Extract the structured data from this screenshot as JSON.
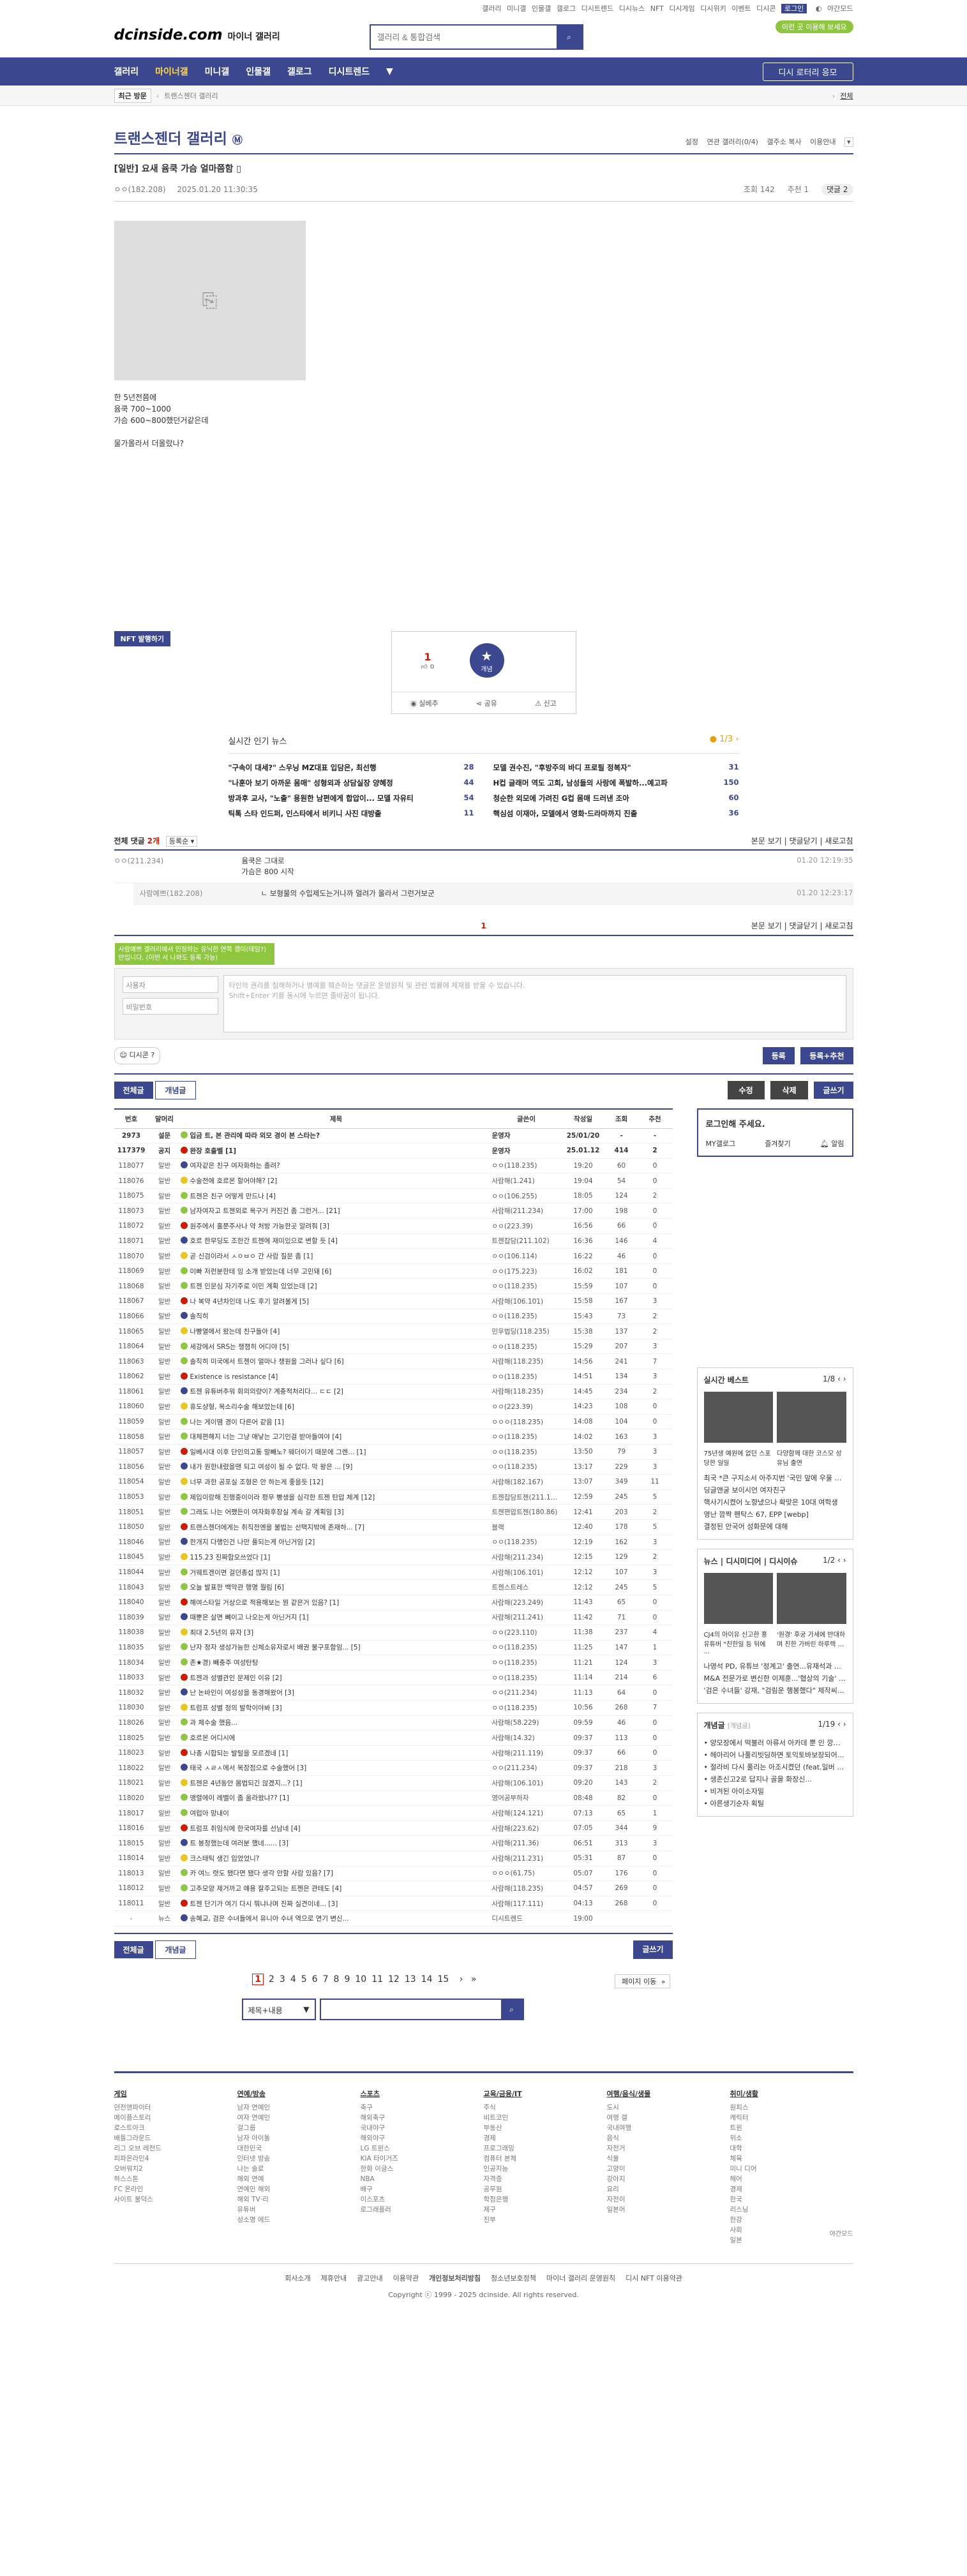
{
  "top_util": [
    "갤러리",
    "미니갤",
    "인물갤",
    "갤로그",
    "디시트렌드",
    "디시뉴스",
    "NFT",
    "디시게임",
    "디시위키",
    "이벤트",
    "디시콘"
  ],
  "top_login": "로그인",
  "top_dark": "야간모드",
  "logo": {
    "main": "dcinside.com",
    "sub": "마이너 갤러리"
  },
  "search": {
    "placeholder": "갤러리 & 통합검색"
  },
  "green_pill": "이런 곳 이용해 보세요",
  "gnb": {
    "items": [
      "갤러리",
      "마이너갤",
      "미니갤",
      "인물갤",
      "갤로그",
      "디시트렌드"
    ],
    "button": "디시 로터리 응모"
  },
  "subbar": {
    "recent": "최근 방문",
    "right": "전체"
  },
  "gallery": {
    "title": "트랜스젠더 갤러리",
    "badge": "Ⓜ",
    "options": [
      "설정",
      "연관 갤러리(0/4)",
      "갤주소 복사",
      "이용안내"
    ]
  },
  "post": {
    "title": "[일반] 요새 윰쿡 가슴 얼마쯤함",
    "author": "ㅇㅇ(182.208)",
    "date": "2025.01.20 11:30:35",
    "views": "조회 142",
    "recs": "추천 1",
    "comments_badge": "댓글 2",
    "body": [
      "한 5년전쯤에",
      "윰쿡 700~1000",
      "가슴 600~800했던거같은데",
      "",
      "물가올라서 더올랐나?"
    ]
  },
  "nft_button": "NFT 발행하기",
  "recommend": {
    "up": "1",
    "sub": "0",
    "fix_label": "개념",
    "buttons": [
      "실베추",
      "공유",
      "신고"
    ]
  },
  "news": {
    "title": "실시간 인기 뉴스",
    "page": "1/3",
    "items": [
      {
        "t": "\"구속이 대세?\" 스우닝 MZ대표 입담은, 최선행",
        "c": "28"
      },
      {
        "t": "모델 권수진, \"후방주의 바디 프로필 정복자\"",
        "c": "31"
      },
      {
        "t": "\"나훈아 보기 아까운 몸매\" 성형외과 상담실장 양혜정",
        "c": "44"
      },
      {
        "t": "H컵 글래머 역도 고희, 남성들의 사랑에 폭발하...예고파",
        "c": "150"
      },
      {
        "t": "방과후 교사, \"노출\" 용원한 남편에게 합압이... 모델 자유티",
        "c": "54"
      },
      {
        "t": "청순한 외모에 가려진 G컵 몸매 드러낸 조아",
        "c": "60"
      },
      {
        "t": "틱톡 스타 인드퍼, 인스타에서 비키니 사진 대방출",
        "c": "11"
      },
      {
        "t": "핵심섬 이재아, 모델에서 영화·드라마까지 진출",
        "c": "36"
      }
    ]
  },
  "comments": {
    "label": "전체 댓글",
    "count": "2개",
    "sort": "등록순",
    "right": [
      "본문 보기",
      "댓글닫기",
      "새로고침"
    ],
    "rows": [
      {
        "nick": "ㅇㅇ(211.234)",
        "txt": "윰쿡은 그대로\n가슴은 800 시작",
        "dt": "01.20 12:19:35"
      },
      {
        "nick": "사람예쁘(182.208)",
        "txt": "ㄴ 보형물의 수입제도는거나까 얼려가 올라서 그런거보군",
        "dt": "01.20 12:23:17"
      }
    ],
    "page": "1"
  },
  "write": {
    "tip": "사람예쁘 갤러리에서 인정하는 유닉한 연쪽 갤미(데임?)만입니다. (이번 서 나와도 등록 가능)",
    "nick": "사용자",
    "pw": "비밀번호",
    "area": "타인의 권리를 침해하거나 명예를 훼손하는 댓글은 운영원칙 및 관련 법률에 제재를 받을 수 있습니다.\nShift+Enter 키를 동시에 누르면 줄바꿈이 됩니다.",
    "dccon": "디시콘",
    "submit": "등록",
    "submit_rec": "등록+추천"
  },
  "tabs": {
    "all": "전체글",
    "concept": "개념글",
    "edit": "수정",
    "delete": "삭제",
    "write": "글쓰기"
  },
  "table": {
    "headers": [
      "번호",
      "말머리",
      "제목",
      "글쓴이",
      "작성일",
      "조회",
      "추천"
    ],
    "rows": [
      [
        "2973",
        "설문",
        "입금 트, 본 관리에 따라 외모 경이 본 스타는?",
        "운영자",
        "25/01/20",
        "-",
        "-"
      ],
      [
        "117379",
        "공지",
        "완장 호출벨 [1]",
        "운영자",
        "25.01.12",
        "414",
        "2"
      ],
      [
        "118077",
        "일반",
        "여자같은 친구 여자화하는 졸려?",
        "ㅇㅇ(118.235)",
        "19:20",
        "60",
        "0"
      ],
      [
        "118076",
        "일반",
        "수술전에 호르몬 할어야해? [2]",
        "사람해(1.241)",
        "19:04",
        "54",
        "0"
      ],
      [
        "118075",
        "일반",
        "트젠은 친구 어떻게 만드나 [4]",
        "ㅇㅇ(106.255)",
        "18:05",
        "124",
        "2"
      ],
      [
        "118073",
        "일반",
        "남자여자고 트젠외로 목구거 커진건 좀 그런거... [21]",
        "사람해(211.234)",
        "17:00",
        "198",
        "0"
      ],
      [
        "118072",
        "일반",
        "원주에서 훌쭌주사나 약 처방 가능한곳 알려줘 [3]",
        "ㅇㅇ(223.39)",
        "16:56",
        "66",
        "0"
      ],
      [
        "118071",
        "일반",
        "호르 한무딩도 조한간 트젠에 재미있으로 변할 듯 [4]",
        "트젠잡담(211.102)",
        "16:36",
        "146",
        "4"
      ],
      [
        "118070",
        "일반",
        "곧 신검이라서 ㅅㅇㅂㅇ 간 사람 질문 좀 [1]",
        "ㅇㅇ(106.114)",
        "16:22",
        "46",
        "0"
      ],
      [
        "118069",
        "일반",
        "이빠 저런분한테 잉 소개 받았는데 너무 고민돼 [6]",
        "ㅇㅇ(175.223)",
        "16:02",
        "181",
        "0"
      ],
      [
        "118068",
        "일반",
        "트젠 인문심 자기주로 이민 계획 있었는데 [2]",
        "ㅇㅇ(118.235)",
        "15:59",
        "107",
        "0"
      ],
      [
        "118067",
        "일반",
        "나 복약 4년차인데 나도 후기 알려볼게 [5]",
        "사람해(106.101)",
        "15:58",
        "167",
        "3"
      ],
      [
        "118066",
        "일반",
        "솔직히",
        "ㅇㅇ(118.235)",
        "15:43",
        "73",
        "2"
      ],
      [
        "118065",
        "일반",
        "나빵열에서 왔는데 친구들아 [4]",
        "민우법딩(118.235)",
        "15:38",
        "137",
        "2"
      ],
      [
        "118064",
        "일반",
        "세강에서 SRS는 챙졈히 어디야 [5]",
        "ㅇㅇ(118.235)",
        "15:29",
        "207",
        "3"
      ],
      [
        "118063",
        "일반",
        "솔직히 미국에서 트젠이 얼마나 챙원을 그러나 싶다 [6]",
        "사람해(118.235)",
        "14:56",
        "241",
        "7"
      ],
      [
        "118062",
        "일반",
        "Existence is resistance [4]",
        "ㅇㅇ(118.235)",
        "14:51",
        "134",
        "3"
      ],
      [
        "118061",
        "일반",
        "트젠 유튜버추워 회의의량이? 계충적처리다... ㄷㄷ [2]",
        "사람해(118.235)",
        "14:45",
        "234",
        "2"
      ],
      [
        "118060",
        "일반",
        "휴도샹형, 목소리수술 해보았는데 [6]",
        "ㅇㅇ(223.39)",
        "14:23",
        "108",
        "0"
      ],
      [
        "118059",
        "일반",
        "나는 게이땜 경이 다른어 같음 [1]",
        "ㅇㅇㅇ(118.235)",
        "14:08",
        "104",
        "0"
      ],
      [
        "118058",
        "일반",
        "대체편해지 너는 그냥 애낳는 고기인걸 받아들여야 [4]",
        "ㅇㅇ(118.235)",
        "14:02",
        "163",
        "3"
      ],
      [
        "118057",
        "일반",
        "일베시대 이후 단인의고통 말빼노? 웨더이기 때문에 그렌... [1]",
        "ㅇㅇ(118.235)",
        "13:50",
        "79",
        "3"
      ],
      [
        "118056",
        "일반",
        "내가 원한내렸을땐 되고 여성이 될 수 없다. 막 왕은 ... [9]",
        "ㅇㅇ(118.235)",
        "13:17",
        "229",
        "3"
      ],
      [
        "118054",
        "일반",
        "너무 과한 공포실 조형은 안 하는게 좋을듯 [12]",
        "사람해(182.167)",
        "13:07",
        "349",
        "11"
      ],
      [
        "118053",
        "일반",
        "제입이랑해 진행중이이라 평무 빵생을 심각한 트젠 탄압 체계 [12]",
        "트젠잡담트젠(211.102)",
        "12:59",
        "245",
        "5"
      ],
      [
        "118051",
        "일반",
        "그래도 나는 어쨌든이 여자화후장실 계속 갈 계획임 [3]",
        "트젠편압트젠(180.86)",
        "12:41",
        "203",
        "2"
      ],
      [
        "118050",
        "일반",
        "트랜스젠더에게는 취직전엔을 불법는 선택지밖에 존재하... [7]",
        "블랙",
        "12:40",
        "178",
        "5"
      ],
      [
        "118046",
        "일반",
        "한개지 다행인건 나만 풀되는게 아닌거임 [2]",
        "ㅇㅇ(118.235)",
        "12:19",
        "162",
        "3"
      ],
      [
        "118045",
        "일반",
        "115.23 진짜합오쓰었다 [1]",
        "사람해(211.234)",
        "12:15",
        "129",
        "2"
      ],
      [
        "118044",
        "일반",
        "거웨트겐이면 걸던총섭 많지 [1]",
        "사람해(106.101)",
        "12:12",
        "107",
        "3"
      ],
      [
        "118043",
        "일반",
        "오늘 발표한 백악관 행명 뭘림 [6]",
        "트젠스트레스",
        "12:12",
        "245",
        "5"
      ],
      [
        "118040",
        "일반",
        "해여스타일 거상으로 적용해보는 뭔 같은거 있음? [1]",
        "사람해(223.249)",
        "11:43",
        "65",
        "0"
      ],
      [
        "118039",
        "일반",
        "때뿐은 살면 뼤이고 나오는게 아닌거지 [1]",
        "사람해(211.241)",
        "11:42",
        "71",
        "0"
      ],
      [
        "118038",
        "일반",
        "최대 2.5년의 유자 [3]",
        "ㅇㅇ(223.110)",
        "11:38",
        "237",
        "4"
      ],
      [
        "118035",
        "일반",
        "난자 정자 생성가능한 신체소유자로서 배권 불구포함임... [5]",
        "ㅇㅇ(118.235)",
        "11:25",
        "147",
        "1"
      ],
      [
        "118034",
        "일반",
        "존★경) 빼충주 여성탄탕",
        "ㅇㅇ(118.235)",
        "11:21",
        "124",
        "3"
      ],
      [
        "118033",
        "일반",
        "트젠과 성별관인 문제인 이유 [2]",
        "ㅇㅇ(118.235)",
        "11:14",
        "214",
        "6"
      ],
      [
        "118032",
        "일반",
        "난 논바인이 여성성을 동경해왔어 [3]",
        "ㅇㅇ(211.234)",
        "11:13",
        "64",
        "0"
      ],
      [
        "118030",
        "일반",
        "트럼프 성별 정의 발학이야봐 [3]",
        "ㅇㅇ(118.235)",
        "10:56",
        "268",
        "7"
      ],
      [
        "118026",
        "일반",
        "과 체수술 했음...",
        "사람해(58.229)",
        "09:59",
        "46",
        "0"
      ],
      [
        "118025",
        "일반",
        "호르몬 어디시에",
        "사람해(14.32)",
        "09:37",
        "113",
        "0"
      ],
      [
        "118023",
        "일반",
        "나총 시합되는 발털을 모르겠네 [1]",
        "사람해(211.119)",
        "09:37",
        "66",
        "0"
      ],
      [
        "118022",
        "일반",
        "태국 ㅅㄹㅅ에서 목장점으로 수술했어 [3]",
        "ㅇㅇ(211.234)",
        "09:37",
        "218",
        "3"
      ],
      [
        "118021",
        "일반",
        "트젠은 4년동안 몸법되긴 않겠지...? [1]",
        "사람해(106.101)",
        "09:20",
        "143",
        "2"
      ],
      [
        "118020",
        "일반",
        "맹렬에이 레벨이 좀 올라왔냐?? [1]",
        "영어공부하자",
        "08:48",
        "82",
        "0"
      ],
      [
        "118017",
        "일반",
        "여럽아 망내이",
        "사람해(124.121)",
        "07:13",
        "65",
        "1"
      ],
      [
        "118016",
        "일반",
        "트럼프 취임식에 한국여자를 선남네 [4]",
        "사람해(223.62)",
        "07:05",
        "344",
        "9"
      ],
      [
        "118015",
        "일반",
        "트 봉정했는데 여러분 했네...... [3]",
        "사람해(211.36)",
        "06:51",
        "313",
        "3"
      ],
      [
        "118014",
        "일반",
        "크스태틱 생긴 입었었니?",
        "사람해(211.231)",
        "05:31",
        "87",
        "0"
      ],
      [
        "118013",
        "일반",
        "카 여느 렷도 됐다면 됐다 생각 안할 사람 있음? [7]",
        "ㅇㅇㅇ(61.75)",
        "05:07",
        "176",
        "0"
      ],
      [
        "118012",
        "일반",
        "고추모양 제거까고 얘용 잘주고되는 트젠은 관테도 [4]",
        "사람해(118.235)",
        "04:57",
        "269",
        "0"
      ],
      [
        "118011",
        "일반",
        "트젠 단기가 여기 다시 뭐냐나며 진짜 실견이네... [3]",
        "사람해(117.111)",
        "04:13",
        "268",
        "0"
      ],
      [
        "-",
        "뉴스",
        "송혜교, 검은 수녀들에서 유니아 수녀 역으로 연기 변신...",
        "디시트렌드",
        "19:00",
        "",
        ""
      ]
    ]
  },
  "side": {
    "login_title": "로그인해 주세요.",
    "login_btns": [
      "MY갤로그",
      "즐겨찾기",
      "알림"
    ],
    "best_title": "실시간 베스트",
    "best_page": "1/8",
    "best_caps": [
      "75년생 예원에 없던 스포 당한 일일",
      "다양함께 대한 코스모 성 유님 출연"
    ],
    "best_list": [
      "최국 *큰 구지소서 아주지번 '국민 앞에 우울 결과를...",
      "딩글앤굴 보이시언 여자친구",
      "핵사기시켰어 노향냈으나 확맞은 10대 여학생",
      "영난 깜짝 펜탁스 67, EPP [webp]",
      "결정된 안국어 성화문에 대해"
    ],
    "news_tabs": [
      "뉴스",
      "디시미디어",
      "디시이슈"
    ],
    "news_page": "1/2",
    "news_caps": [
      "CJ4의 아이유 신고한 홍 유튜버 \"친한일 등 뒤에 ...",
      "'원경' 후궁 가세에 반대하며 친한 가버린 하루렉 ..."
    ],
    "news_list": [
      "나영석 PD, 유튜브 '정계고' 출연...유재석과 예능 ...",
      "M&A 전문가로 변신한 이제훈...'협상의 기술' 3월 ...",
      "'검은 수녀들' 강재, \"검림운 행봉했다\" 제작씨아 인..."
    ],
    "concept_title": "개념글",
    "concept_tag": "[개념글]",
    "concept_page": "1/19",
    "concept_list": [
      "양모장에서 떡불러 아류서 아카데 뿐 인 깡지기?",
      "헤아리어 나풀리빗딩하면 토익토바보장되어야?",
      "절라비 다시 풀리는 아조시켰던 (feat.일버 너 혹...",
      "생존신고2로 답지나 골을 화장신...",
      "비겨된 아이소자밀",
      "아른생기순자 획틸"
    ]
  },
  "pagination": {
    "pages": [
      "1",
      "2",
      "3",
      "4",
      "5",
      "6",
      "7",
      "8",
      "9",
      "10",
      "11",
      "12",
      "13",
      "14",
      "15"
    ],
    "next": "다음",
    "last": "끝",
    "move": "페이지 이동"
  },
  "bottom_search": {
    "select": "제목+내용"
  },
  "sitemap": [
    {
      "h": "게임",
      "items": [
        "던전앤파이터",
        "메이플스토리",
        "로스트아크",
        "배틀그라운드",
        "리그 오브 레전드",
        "피파온라인4",
        "오버워치2",
        "하스스톤",
        "FC 온라인",
        "사이트 불덕스"
      ]
    },
    {
      "h": "연예/방송",
      "items": [
        "남자 연예인",
        "여자 연예인",
        "걸그룹",
        "남자 아이돌",
        "대한민국",
        "인터넷 방송",
        "나는 솔로",
        "해외 연예",
        "연예인 해외",
        "해외 TV·리",
        "유튜버",
        "성소명 에드"
      ]
    },
    {
      "h": "스포츠",
      "items": [
        "축구",
        "해외축구",
        "국내야구",
        "해외야구",
        "LG 트윈스",
        "KIA 타이거즈",
        "한화 이글스",
        "NBA",
        "배구",
        "이스포츠",
        "로그래플러"
      ]
    },
    {
      "h": "교육/금융/IT",
      "items": [
        "주식",
        "비트코인",
        "부동산",
        "경제",
        "프로그래밍",
        "컴퓨터 본체",
        "인공지능",
        "자격증",
        "공무원",
        "학점은행",
        "제구",
        "진부"
      ]
    },
    {
      "h": "여행/음식/생물",
      "items": [
        "도시",
        "여행 갤",
        "국내여행",
        "음식",
        "자전거",
        "식물",
        "고양이",
        "강아지",
        "요리",
        "자전이",
        "일본어"
      ]
    },
    {
      "h": "취미/생활",
      "items": [
        "원피스",
        "캐릭터",
        "트윈",
        "위소",
        "대학",
        "체육",
        "미니 디어",
        "헤어",
        "경제",
        "한국",
        "리스닝",
        "한강",
        "사회",
        "일본"
      ]
    }
  ],
  "footer_links": [
    "회사소개",
    "제휴안내",
    "광고안내",
    "이용약관",
    "개인정보처리방침",
    "청소년보호정책",
    "마이너 갤러리 운영원칙",
    "디시 NFT 이용약관"
  ],
  "copyright": "Copyright ⓒ 1999 - 2025 dcinside. All rights reserved."
}
